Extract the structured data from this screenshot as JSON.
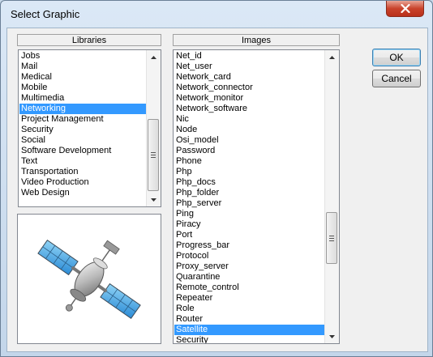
{
  "window": {
    "title": "Select Graphic"
  },
  "libraries": {
    "header": "Libraries",
    "items": [
      "Jobs",
      "Mail",
      "Medical",
      "Mobile",
      "Multimedia",
      "Networking",
      "Project Management",
      "Security",
      "Social",
      "Software Development",
      "Text",
      "Transportation",
      "Video Production",
      "Web Design"
    ],
    "selected": "Networking"
  },
  "images": {
    "header": "Images",
    "items": [
      "Net_id",
      "Net_user",
      "Network_card",
      "Network_connector",
      "Network_monitor",
      "Network_software",
      "Nic",
      "Node",
      "Osi_model",
      "Password",
      "Phone",
      "Php",
      "Php_docs",
      "Php_folder",
      "Php_server",
      "Ping",
      "Piracy",
      "Port",
      "Progress_bar",
      "Protocol",
      "Proxy_server",
      "Quarantine",
      "Remote_control",
      "Repeater",
      "Role",
      "Router",
      "Satellite",
      "Security"
    ],
    "selected": "Satellite"
  },
  "buttons": {
    "ok": "OK",
    "cancel": "Cancel"
  },
  "preview": {
    "icon": "satellite-icon"
  },
  "colors": {
    "selection": "#3399ff",
    "close_button": "#c9432c"
  }
}
